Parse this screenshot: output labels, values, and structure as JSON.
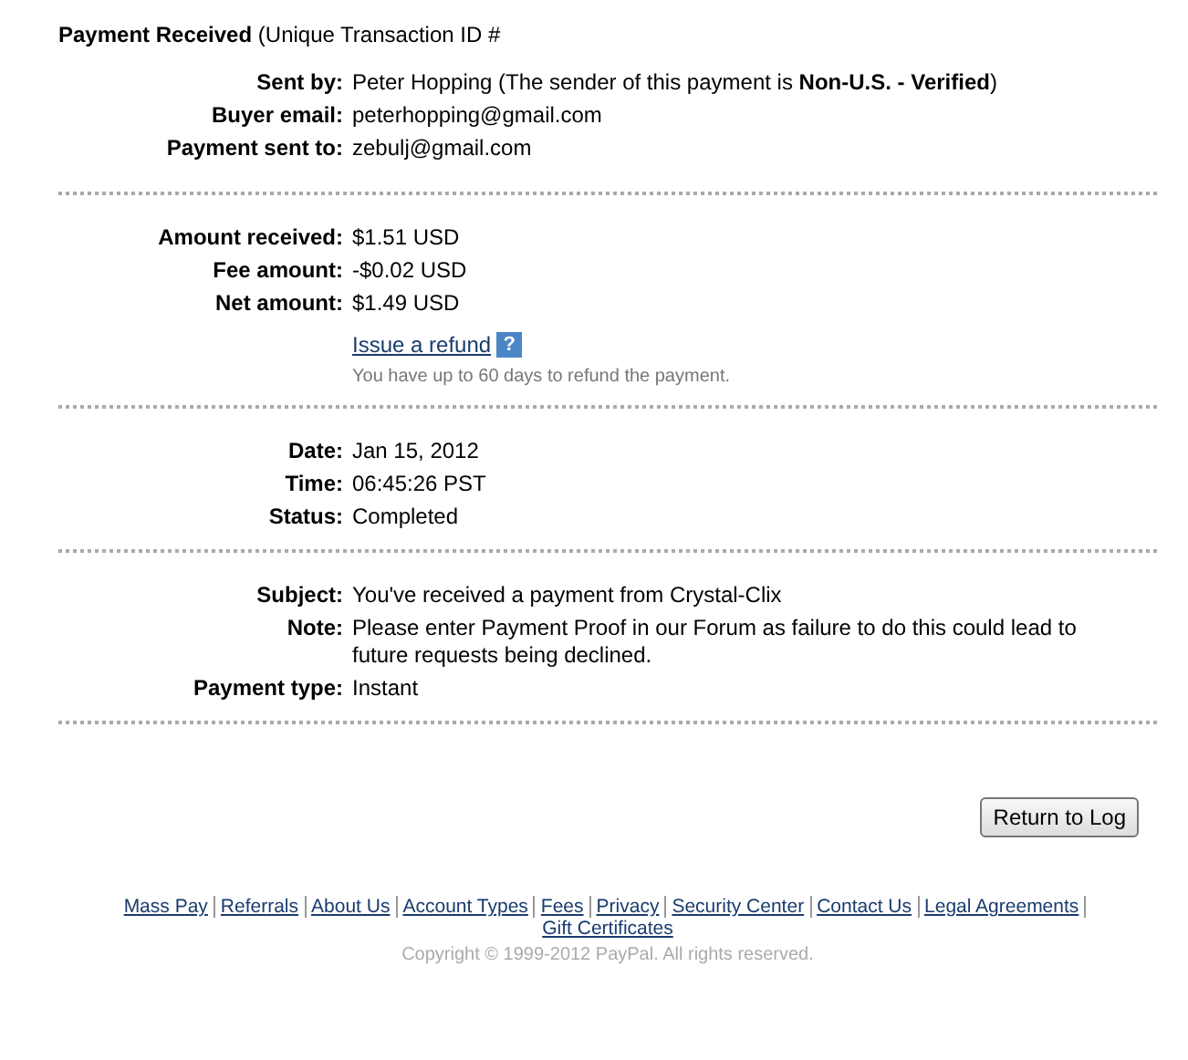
{
  "header": {
    "title": "Payment Received",
    "subtitle": "(Unique Transaction ID #"
  },
  "sections": [
    {
      "rows": [
        {
          "label": "Sent by:",
          "value": "Peter Hopping (The sender of this payment is **Non-U.S. - Verified**)"
        },
        {
          "label": "Buyer email:",
          "value": "peterhopping@gmail.com"
        },
        {
          "label": "Payment sent to:",
          "value": "zebulj@gmail.com"
        }
      ]
    },
    {
      "rows": [
        {
          "label": "Amount received:",
          "value": "$1.51 USD"
        },
        {
          "label": "Fee amount:",
          "value": "-$0.02 USD"
        },
        {
          "label": "Net amount:",
          "value": "$1.49 USD"
        }
      ],
      "refund": {
        "link": "Issue a refund",
        "help": "?",
        "hint": "You have up to 60 days to refund the payment."
      }
    },
    {
      "rows": [
        {
          "label": "Date:",
          "value": "Jan 15, 2012"
        },
        {
          "label": "Time:",
          "value": "06:45:26 PST"
        },
        {
          "label": "Status:",
          "value": "Completed"
        }
      ]
    },
    {
      "rows": [
        {
          "label": "Subject:",
          "value": "You've received a payment from Crystal-Clix"
        },
        {
          "label": "Note:",
          "value": "Please enter Payment Proof in our Forum as failure to do this could lead to future requests being declined."
        },
        {
          "label": "Payment type:",
          "value": "Instant"
        }
      ]
    }
  ],
  "button": "Return to Log",
  "footer_links": [
    "Mass Pay",
    "Referrals",
    "About Us",
    "Account Types",
    "Fees",
    "Privacy",
    "Security Center",
    "Contact Us",
    "Legal Agreements",
    "Gift Certificates"
  ],
  "copyright": "Copyright © 1999-2012 PayPal. All rights reserved."
}
